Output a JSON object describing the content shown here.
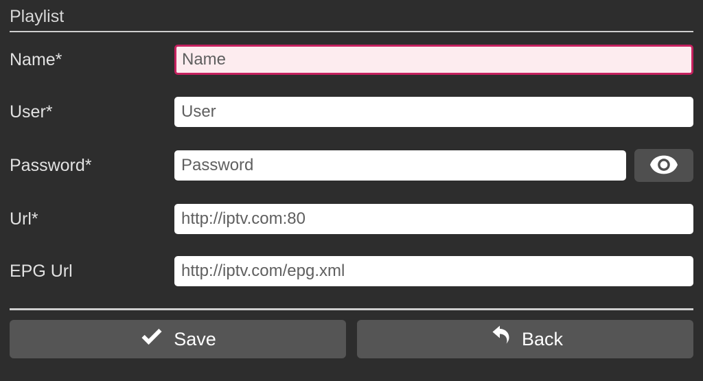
{
  "section_title": "Playlist",
  "fields": {
    "name": {
      "label": "Name*",
      "placeholder": "Name",
      "value": ""
    },
    "user": {
      "label": "User*",
      "placeholder": "User",
      "value": ""
    },
    "password": {
      "label": "Password*",
      "placeholder": "Password",
      "value": ""
    },
    "url": {
      "label": "Url*",
      "placeholder": "http://iptv.com:80",
      "value": ""
    },
    "epg": {
      "label": "EPG Url",
      "placeholder": "http://iptv.com/epg.xml",
      "value": ""
    }
  },
  "buttons": {
    "save": "Save",
    "back": "Back"
  }
}
